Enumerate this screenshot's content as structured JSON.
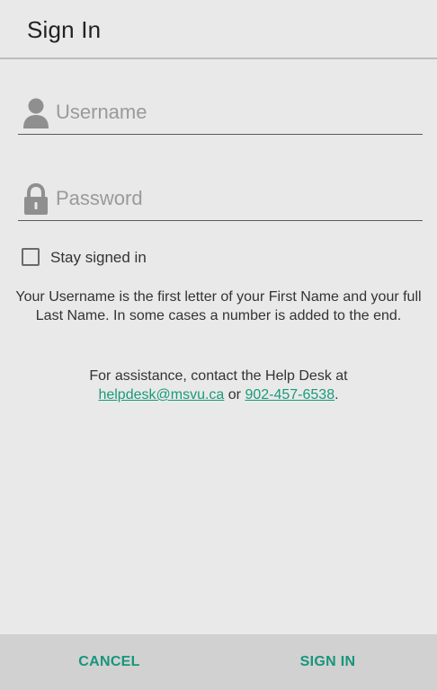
{
  "header": {
    "title": "Sign In"
  },
  "form": {
    "username": {
      "placeholder": "Username",
      "value": "",
      "icon": "person-icon"
    },
    "password": {
      "placeholder": "Password",
      "value": "",
      "icon": "lock-icon"
    },
    "stay_signed_in": {
      "label": "Stay signed in",
      "checked": false
    }
  },
  "info": {
    "username_hint": "Your Username is the first letter of your First Name and your full Last Name. In some cases a number is added to the end.",
    "help_prefix": "For assistance, contact the Help Desk at",
    "help_email": "helpdesk@msvu.ca",
    "help_or": "or",
    "help_phone": "902-457-6538",
    "help_suffix": "."
  },
  "footer": {
    "cancel_label": "CANCEL",
    "signin_label": "SIGN IN"
  },
  "colors": {
    "background": "#e9e9e9",
    "footer_background": "#d1d1d1",
    "accent": "#16967a",
    "link": "#1a9a7a"
  }
}
